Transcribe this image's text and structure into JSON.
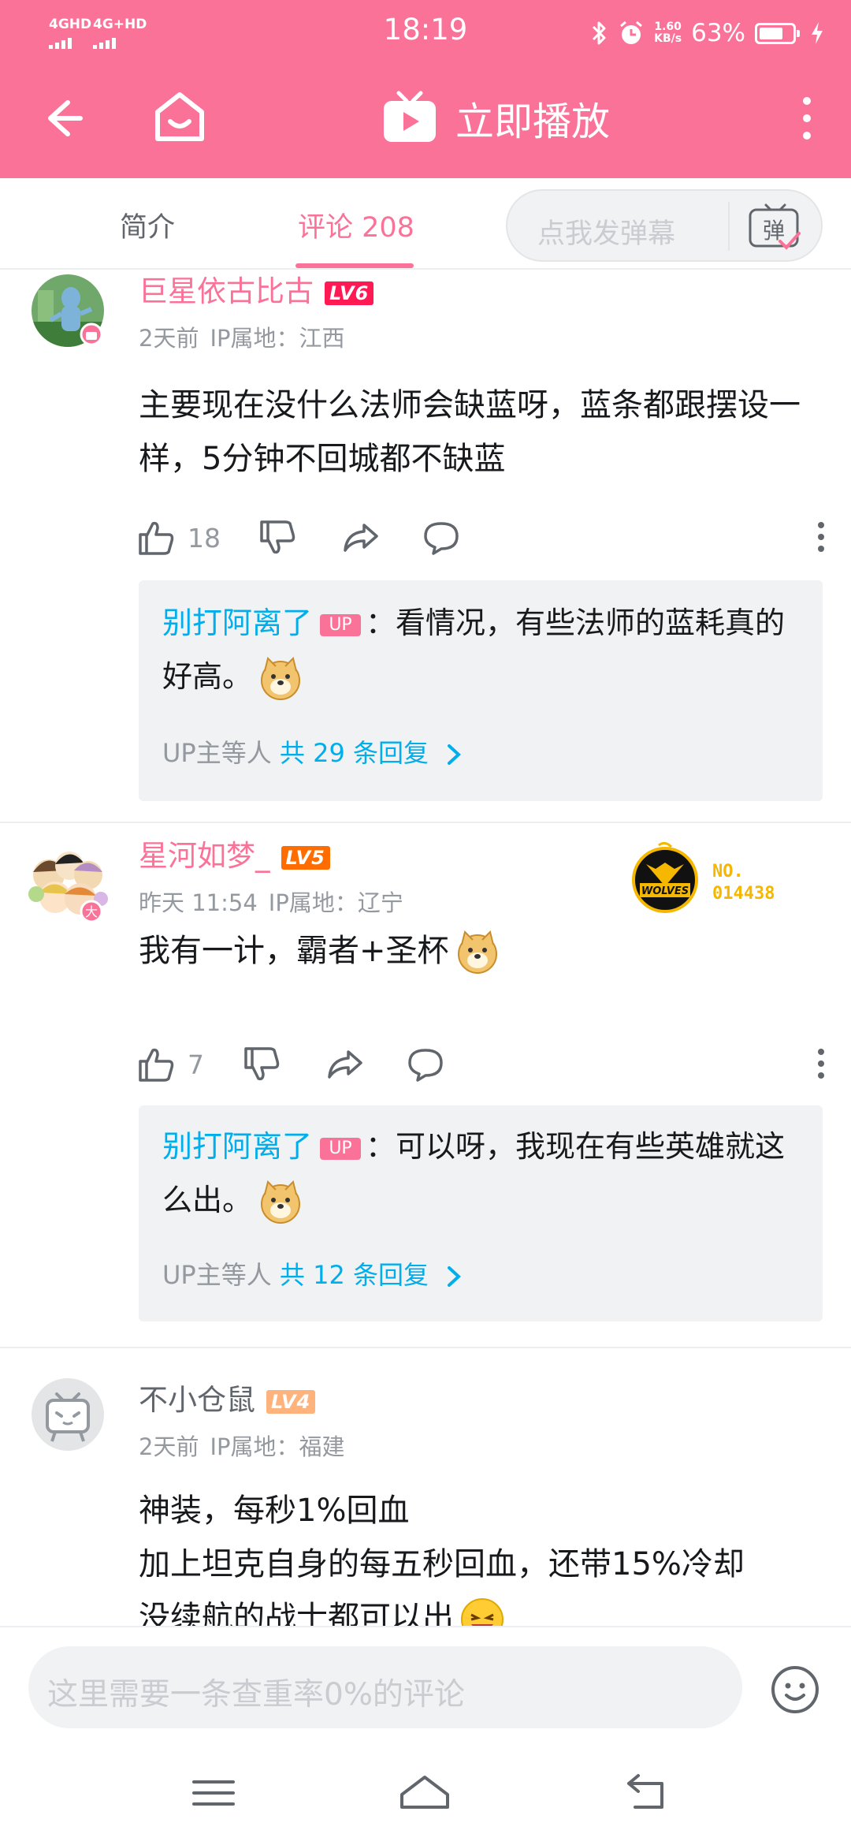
{
  "status_bar": {
    "signal_1": "4GHD",
    "signal_2": "4G+HD",
    "time": "18:19",
    "speed": "1.60",
    "speed_unit": "KB/s",
    "battery": "63%",
    "battery_level": 0.63
  },
  "title_bar": {
    "play_label": "立即播放"
  },
  "tabs": {
    "intro": "简介",
    "comments": "评论 208",
    "danmaku_placeholder": "点我发弹幕",
    "danmaku_icon_char": "弹"
  },
  "comments": [
    {
      "username": "巨星依古比古",
      "level": "LV6",
      "time": "2天前",
      "ip": "IP属地：江西",
      "text": "主要现在没什么法师会缺蓝呀，蓝条都跟摆设一样，5分钟不回城都不缺蓝",
      "likes": "18",
      "reply": {
        "name": "别打阿离了",
        "badge": "UP",
        "text": "：看情况，有些法师的蓝耗真的好高。",
        "more_prefix": "UP主等人",
        "more_count": "共 29 条回复"
      }
    },
    {
      "username": "星河如梦_",
      "level": "LV5",
      "time": "昨天 11:54",
      "ip": "IP属地：辽宁",
      "text": "我有一计，霸者+圣杯",
      "likes": "7",
      "medal_no": "NO.",
      "medal_num": "014438",
      "medal_text": "WOLVES",
      "avatar_badge": "大",
      "reply": {
        "name": "别打阿离了",
        "badge": "UP",
        "text": "：可以呀，我现在有些英雄就这么出。",
        "more_prefix": "UP主等人",
        "more_count": "共 12 条回复"
      }
    },
    {
      "username": "不小仓鼠",
      "level": "LV4",
      "time": "2天前",
      "ip": "IP属地：福建",
      "line1": "神装，每秒1%回血",
      "line2": "加上坦克自身的每五秒回血，还带15%冷却",
      "line3": "没续航的战士都可以出"
    }
  ],
  "bottom": {
    "input_placeholder": "这里需要一条查重率0%的评论"
  },
  "colors": {
    "brand_pink": "#fb7299",
    "link_blue": "#00aeec",
    "lv6": "#ff1a53",
    "lv5": "#ff6c00",
    "lv4": "#ffb37c"
  }
}
